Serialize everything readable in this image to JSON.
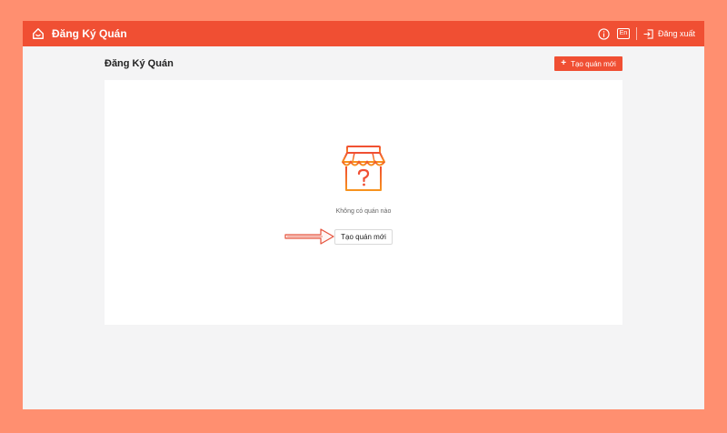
{
  "header": {
    "title": "Đăng Ký Quán",
    "lang_label": "En",
    "logout_label": "Đăng xuất",
    "icons": [
      "home-icon",
      "info-icon",
      "logout-icon"
    ]
  },
  "page": {
    "title": "Đăng Ký Quán",
    "create_button_label": "Tạo quán mới"
  },
  "empty_state": {
    "icon": "store-icon",
    "message": "Không có quán nào",
    "create_button_label": "Tạo quán mới"
  },
  "colors": {
    "primary": "#f04f33",
    "frame": "#ff8f70",
    "background": "#f4f4f5",
    "panel": "#ffffff",
    "icon_orange": "#f7931e"
  }
}
